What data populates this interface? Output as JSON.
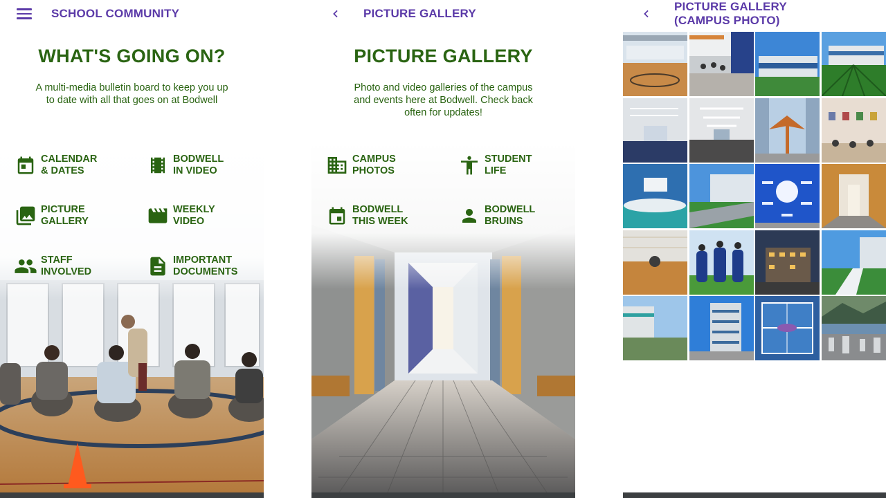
{
  "screen_community": {
    "title": "SCHOOL COMMUNITY",
    "heading": "WHAT'S GOING ON?",
    "description": "A multi-media bulletin board to keep you up to date with all that goes on at Bodwell",
    "tiles": [
      {
        "label": "CALENDAR\n& DATES",
        "icon": "calendar-icon"
      },
      {
        "label": "BODWELL\nIN VIDEO",
        "icon": "film-icon"
      },
      {
        "label": "PICTURE\nGALLERY",
        "icon": "photo-library-icon"
      },
      {
        "label": "WEEKLY\nVIDEO",
        "icon": "clapperboard-icon"
      },
      {
        "label": "STAFF\nINVOLVED",
        "icon": "people-icon"
      },
      {
        "label": "IMPORTANT\nDOCUMENTS",
        "icon": "document-icon"
      }
    ]
  },
  "screen_gallery": {
    "title": "PICTURE GALLERY",
    "heading": "PICTURE GALLERY",
    "description": "Photo and video galleries of the campus and events here at Bodwell. Check back often for updates!",
    "tiles": [
      {
        "label": "CAMPUS\nPHOTOS",
        "icon": "building-icon"
      },
      {
        "label": "STUDENT\nLIFE",
        "icon": "person-icon"
      },
      {
        "label": "BODWELL\nTHIS WEEK",
        "icon": "calendar-event-icon"
      },
      {
        "label": "BODWELL\nBRUINS",
        "icon": "person-profile-icon"
      }
    ]
  },
  "screen_campus": {
    "title_line1": "PICTURE GALLERY",
    "title_line2": "(CAMPUS PHOTO)",
    "thumbnail_count": 20
  },
  "colors": {
    "title_purple": "#5b3aa8",
    "text_green": "#2a6412",
    "bottom_bar": "#3c3f41"
  }
}
